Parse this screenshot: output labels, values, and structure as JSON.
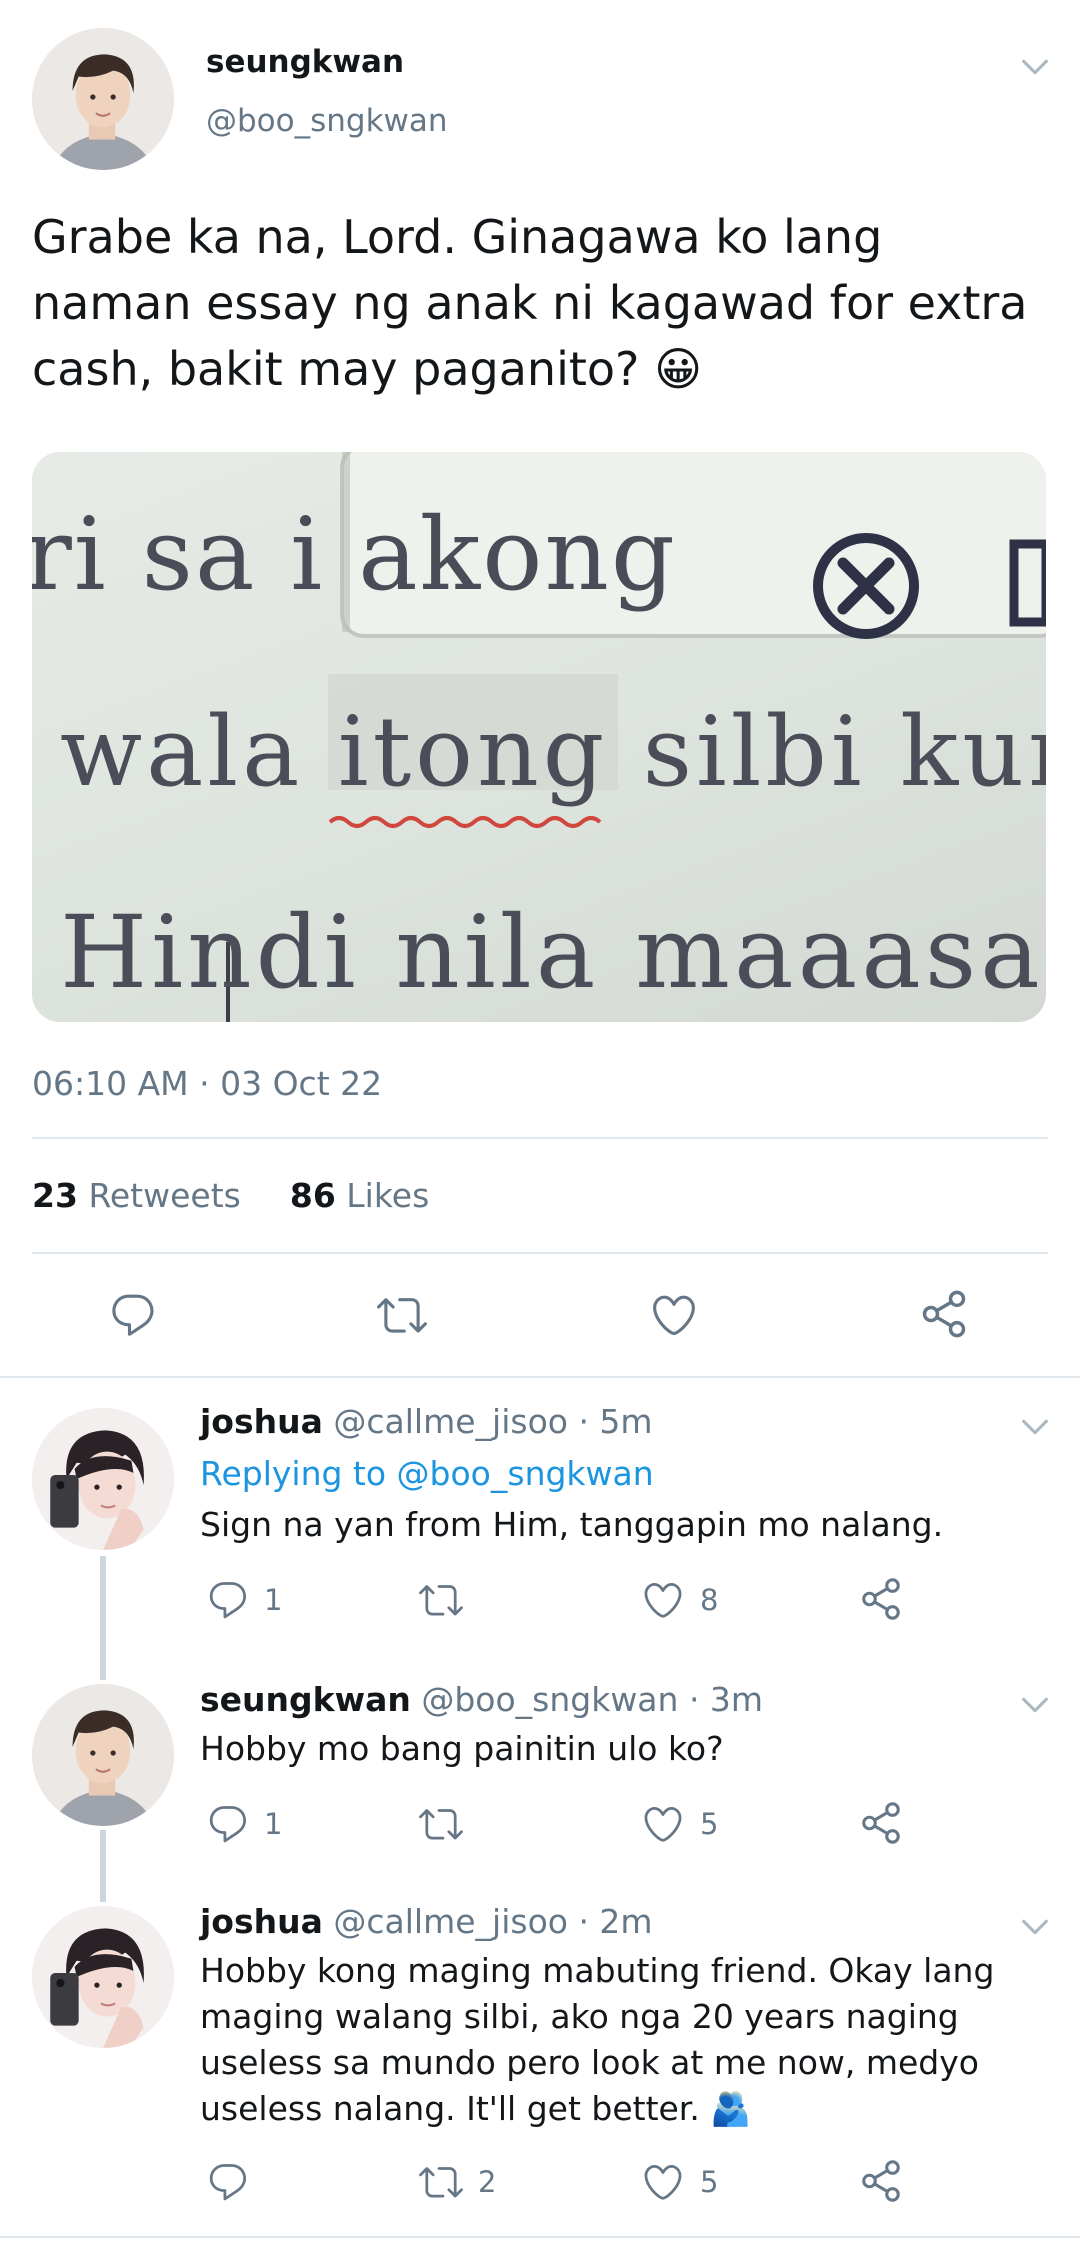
{
  "tweet": {
    "display_name": "seungkwan",
    "handle": "@boo_sngkwan",
    "text": "Grabe ka na, Lord. Ginagawa ko lang naman essay ng anak ni kagawad for extra cash, bakit may paganito? 😀",
    "image_lines": [
      "ri sa i  akong",
      "wala itong silbi kung",
      "Hindi nila maaasaha"
    ],
    "timestamp": "06:10 AM · 03 Oct 22",
    "retweets_count": "23",
    "retweets_label": "Retweets",
    "likes_count": "86",
    "likes_label": "Likes"
  },
  "replies": [
    {
      "name": "joshua",
      "meta": "@callme_jisoo · 5m",
      "replying_prefix": "Replying to",
      "replying_handle": "@boo_sngkwan",
      "text": "Sign na yan from Him, tanggapin mo nalang.",
      "reply_count": "1",
      "retweet_count": "",
      "like_count": "8"
    },
    {
      "name": "seungkwan",
      "meta": "@boo_sngkwan · 3m",
      "text": "Hobby mo bang painitin ulo ko?",
      "reply_count": "1",
      "retweet_count": "",
      "like_count": "5"
    },
    {
      "name": "joshua",
      "meta": "@callme_jisoo · 2m",
      "text": "Hobby kong maging mabuting friend. Okay lang maging walang silbi, ako nga 20 years naging useless sa mundo pero look at me now, medyo useless nalang. It'll get better. 🫂",
      "reply_count": "",
      "retweet_count": "2",
      "like_count": "5"
    }
  ],
  "icons": {
    "chevron": "chevron-down-icon",
    "reply": "reply-icon",
    "retweet": "retweet-icon",
    "like": "heart-icon",
    "share": "share-icon"
  },
  "colors": {
    "text": "#14171a",
    "muted": "#657786",
    "link": "#1b95e0",
    "divider": "#e1e8ed",
    "spellcheck": "#d0473e"
  }
}
